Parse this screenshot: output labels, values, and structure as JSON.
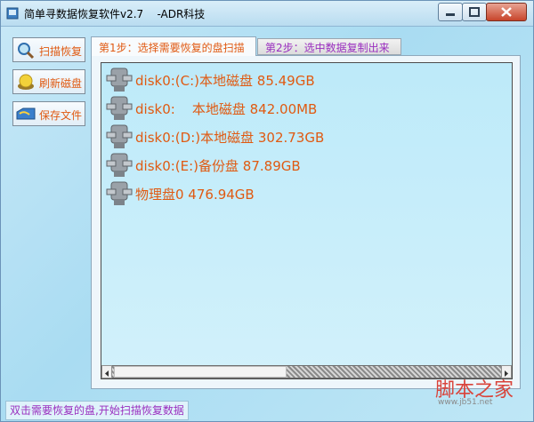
{
  "window": {
    "title": "简单寻数据恢复软件v2.7    -ADR科技"
  },
  "sidebar": {
    "items": [
      {
        "label": "扫描恢复",
        "icon": "search-icon"
      },
      {
        "label": "刷新磁盘",
        "icon": "refresh-icon"
      },
      {
        "label": "保存文件",
        "icon": "save-icon"
      }
    ]
  },
  "tabs": [
    {
      "label": "第1步：选择需要恢复的盘扫描",
      "active": true
    },
    {
      "label": "第2步：选中数据复制出来",
      "active": false
    }
  ],
  "disks": [
    {
      "label": "disk0:(C:)本地磁盘 85.49GB",
      "icon": "disk-drive-icon"
    },
    {
      "label": "disk0:    本地磁盘 842.00MB",
      "icon": "disk-drive-icon"
    },
    {
      "label": "disk0:(D:)本地磁盘 302.73GB",
      "icon": "disk-drive-icon"
    },
    {
      "label": "disk0:(E:)备份盘 87.89GB",
      "icon": "disk-drive-icon"
    },
    {
      "label": "物理盘0 476.94GB",
      "icon": "disk-drive-icon"
    }
  ],
  "statusbar": {
    "text": "双击需要恢复的盘,开始扫描恢复数据"
  },
  "watermark": {
    "text": "脚本之家",
    "url": "www.jb51.net"
  },
  "colors": {
    "accent_text": "#e05a12",
    "tab_inactive_text": "#9a2fbf",
    "list_background": "#bdeaf9"
  }
}
